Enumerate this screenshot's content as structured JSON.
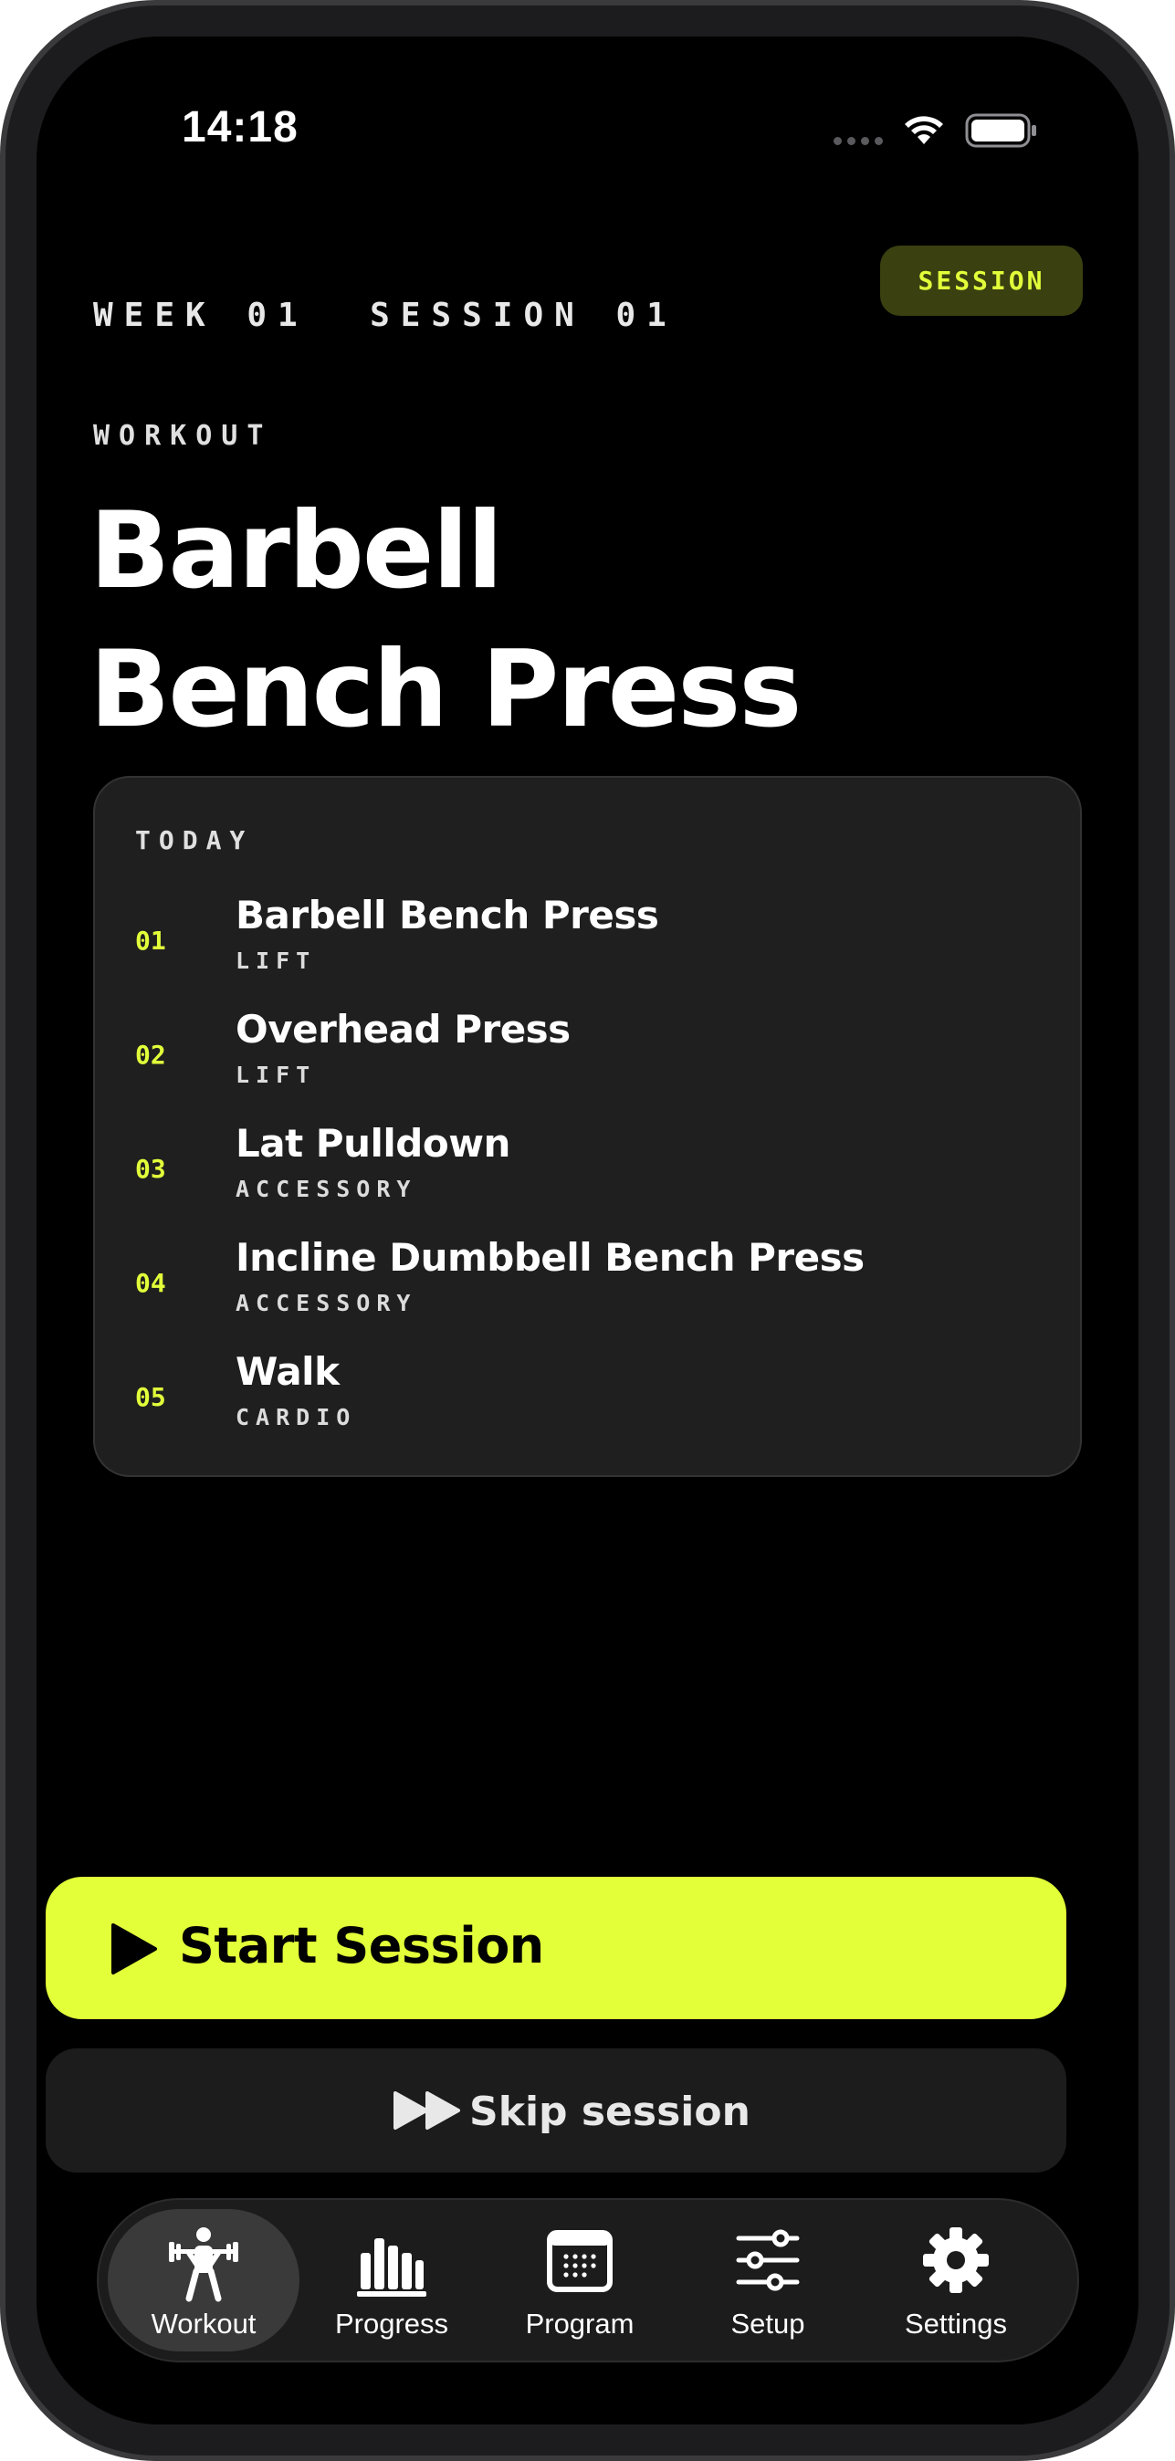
{
  "status_bar": {
    "time": "14:18"
  },
  "header": {
    "week": "WEEK 01",
    "session": "SESSION 01",
    "pill_label": "SESSION"
  },
  "workout": {
    "kicker": "WORKOUT",
    "title_line1": "Barbell",
    "title_line2": "Bench Press"
  },
  "today": {
    "label": "TODAY",
    "exercises": [
      {
        "num": "01",
        "name": "Barbell Bench Press",
        "category": "LIFT"
      },
      {
        "num": "02",
        "name": "Overhead Press",
        "category": "LIFT"
      },
      {
        "num": "03",
        "name": "Lat Pulldown",
        "category": "ACCESSORY"
      },
      {
        "num": "04",
        "name": "Incline Dumbbell Bench Press",
        "category": "ACCESSORY"
      },
      {
        "num": "05",
        "name": "Walk",
        "category": "CARDIO"
      }
    ]
  },
  "actions": {
    "start_label": "Start Session",
    "skip_label": "Skip session"
  },
  "tabs": [
    {
      "label": "Workout",
      "icon": "weightlifter-icon",
      "active": true
    },
    {
      "label": "Progress",
      "icon": "bar-chart-icon",
      "active": false
    },
    {
      "label": "Program",
      "icon": "calendar-icon",
      "active": false
    },
    {
      "label": "Setup",
      "icon": "sliders-icon",
      "active": false
    },
    {
      "label": "Settings",
      "icon": "gear-icon",
      "active": false
    }
  ],
  "colors": {
    "accent": "#e2ff3a",
    "background": "#000000",
    "card": "#1f1f1f"
  }
}
